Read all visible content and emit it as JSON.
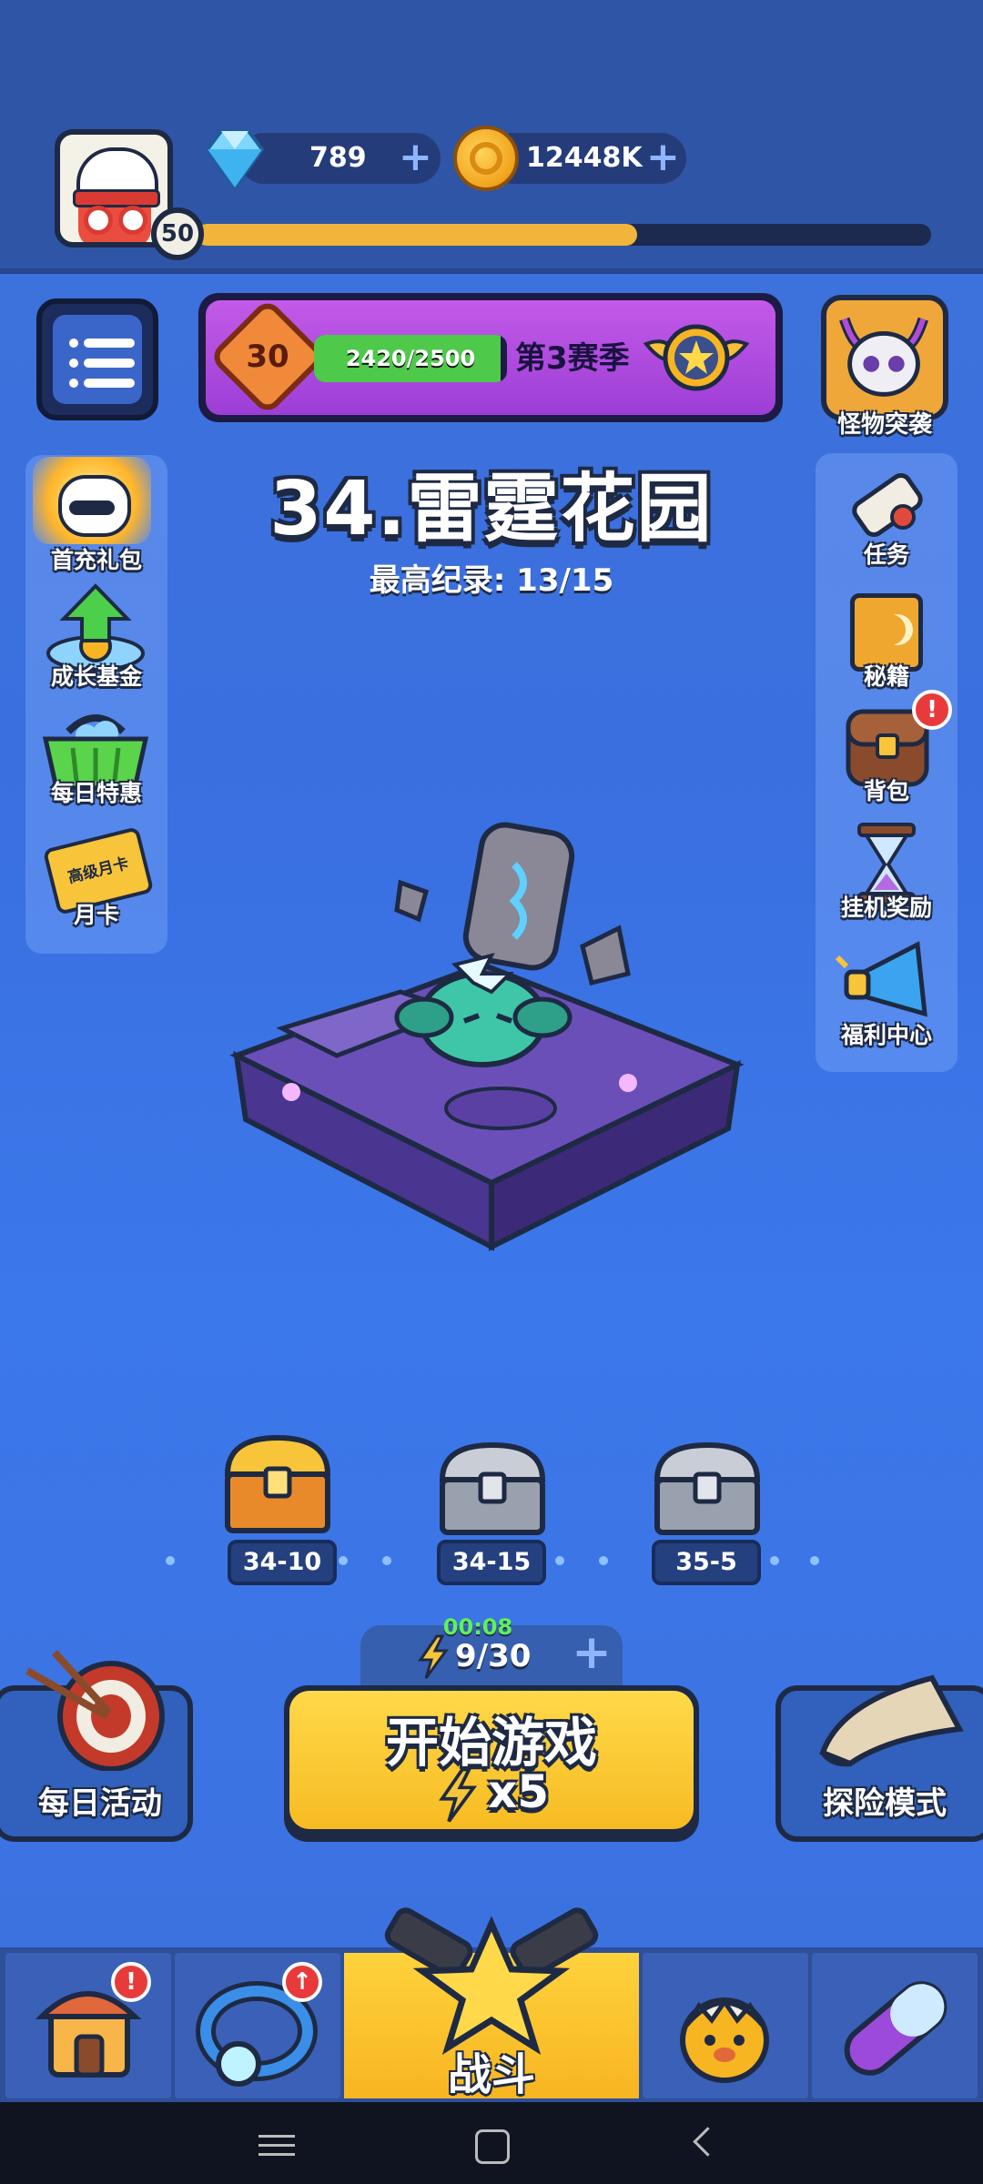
{
  "header": {
    "player_level": "50",
    "xp_progress_fraction": 0.6,
    "gems": "789",
    "gold": "12448K"
  },
  "season": {
    "rank": "30",
    "progress_text": "2420/2500",
    "progress_fraction": 0.968,
    "label": "第3赛季"
  },
  "monster_raid": {
    "label": "怪物突袭"
  },
  "left_menu": [
    {
      "label": "首充礼包",
      "icon": "first-charge-gift-icon"
    },
    {
      "label": "成长基金",
      "icon": "growth-fund-icon"
    },
    {
      "label": "每日特惠",
      "icon": "daily-deal-basket-icon"
    },
    {
      "label": "月卡",
      "icon": "monthly-card-icon",
      "card_text": "高级月卡"
    }
  ],
  "right_menu": [
    {
      "label": "任务",
      "icon": "quest-scroll-icon"
    },
    {
      "label": "秘籍",
      "icon": "spellbook-icon"
    },
    {
      "label": "背包",
      "icon": "backpack-icon",
      "badge": "!"
    },
    {
      "label": "挂机奖励",
      "icon": "hourglass-icon"
    },
    {
      "label": "福利中心",
      "icon": "megaphone-icon"
    }
  ],
  "stage": {
    "title": "34.雷霆花园",
    "record": "最高纪录:  13/15"
  },
  "chests": [
    {
      "label": "34-10",
      "type": "gold"
    },
    {
      "label": "34-15",
      "type": "silver"
    },
    {
      "label": "35-5",
      "type": "silver"
    }
  ],
  "energy": {
    "timer": "00:08",
    "value": "9/30"
  },
  "buttons": {
    "daily_activity": "每日活动",
    "start_game": "开始游戏",
    "start_cost": "x5",
    "adventure_mode": "探险模式"
  },
  "bottom_nav": {
    "battle_label": "战斗",
    "badge": "!"
  },
  "colors": {
    "accent_yellow": "#f7bb22",
    "season_purple": "#c35ae8",
    "background_blue": "#3a6fe0"
  }
}
